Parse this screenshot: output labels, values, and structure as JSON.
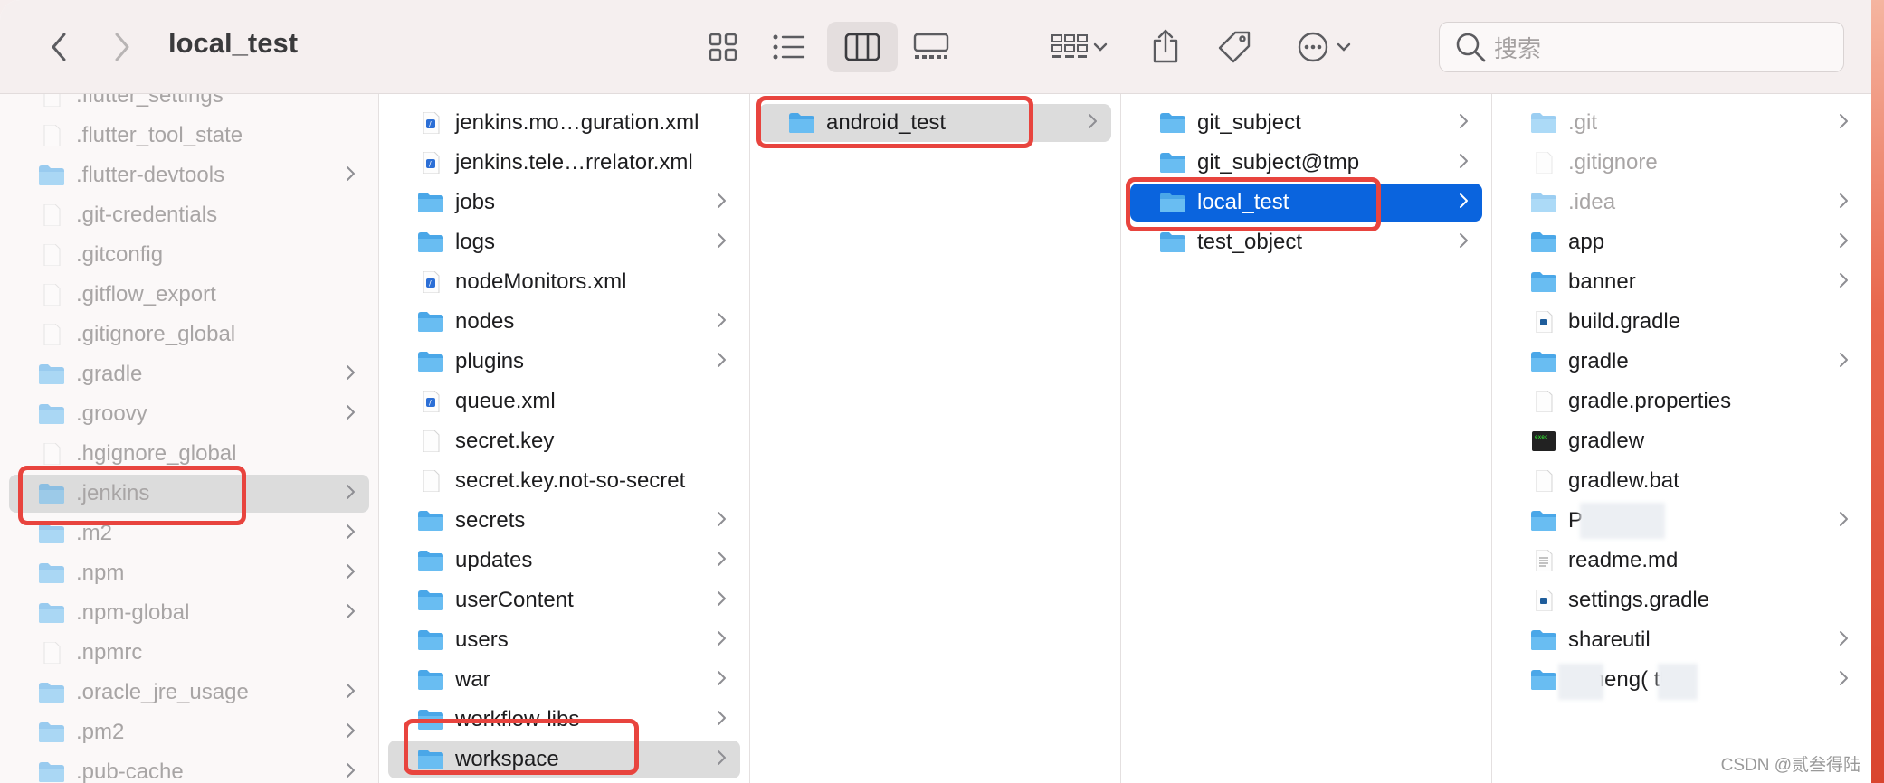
{
  "window": {
    "title": "local_test"
  },
  "toolbar": {
    "back": "chevron-left-icon",
    "forward": "chevron-right-icon",
    "search_placeholder": "搜索"
  },
  "columns": [
    {
      "items": [
        {
          "label": ".flutter_settings",
          "type": "file",
          "dim": true
        },
        {
          "label": ".flutter_tool_state",
          "type": "file",
          "dim": true
        },
        {
          "label": ".flutter-devtools",
          "type": "folder",
          "dim": true,
          "chevron": true
        },
        {
          "label": ".git-credentials",
          "type": "file",
          "dim": true
        },
        {
          "label": ".gitconfig",
          "type": "file",
          "dim": true
        },
        {
          "label": ".gitflow_export",
          "type": "file",
          "dim": true
        },
        {
          "label": ".gitignore_global",
          "type": "file",
          "dim": true
        },
        {
          "label": ".gradle",
          "type": "folder",
          "dim": true,
          "chevron": true
        },
        {
          "label": ".groovy",
          "type": "folder",
          "dim": true,
          "chevron": true
        },
        {
          "label": ".hgignore_global",
          "type": "file",
          "dim": true
        },
        {
          "label": ".jenkins",
          "type": "folder",
          "dim": true,
          "chevron": true,
          "selected": "gray"
        },
        {
          "label": ".m2",
          "type": "folder",
          "dim": true,
          "chevron": true
        },
        {
          "label": ".npm",
          "type": "folder",
          "dim": true,
          "chevron": true
        },
        {
          "label": ".npm-global",
          "type": "folder",
          "dim": true,
          "chevron": true
        },
        {
          "label": ".npmrc",
          "type": "file",
          "dim": true
        },
        {
          "label": ".oracle_jre_usage",
          "type": "folder",
          "dim": true,
          "chevron": true
        },
        {
          "label": ".pm2",
          "type": "folder",
          "dim": true,
          "chevron": true
        },
        {
          "label": ".pub-cache",
          "type": "folder",
          "dim": true,
          "chevron": true
        }
      ]
    },
    {
      "items": [
        {
          "label": "jenkins.mo…guration.xml",
          "type": "xml"
        },
        {
          "label": "jenkins.tele…rrelator.xml",
          "type": "xml"
        },
        {
          "label": "jobs",
          "type": "folder",
          "chevron": true
        },
        {
          "label": "logs",
          "type": "folder",
          "chevron": true
        },
        {
          "label": "nodeMonitors.xml",
          "type": "xml"
        },
        {
          "label": "nodes",
          "type": "folder",
          "chevron": true
        },
        {
          "label": "plugins",
          "type": "folder",
          "chevron": true
        },
        {
          "label": "queue.xml",
          "type": "xml"
        },
        {
          "label": "secret.key",
          "type": "file"
        },
        {
          "label": "secret.key.not-so-secret",
          "type": "file"
        },
        {
          "label": "secrets",
          "type": "folder",
          "chevron": true
        },
        {
          "label": "updates",
          "type": "folder",
          "chevron": true
        },
        {
          "label": "userContent",
          "type": "folder",
          "chevron": true
        },
        {
          "label": "users",
          "type": "folder",
          "chevron": true
        },
        {
          "label": "war",
          "type": "folder",
          "chevron": true
        },
        {
          "label": "workflow-libs",
          "type": "folder",
          "chevron": true
        },
        {
          "label": "workspace",
          "type": "folder",
          "chevron": true,
          "selected": "gray"
        }
      ]
    },
    {
      "items": [
        {
          "label": "android_test",
          "type": "folder",
          "chevron": true,
          "selected": "gray"
        }
      ]
    },
    {
      "items": [
        {
          "label": "git_subject",
          "type": "folder",
          "chevron": true
        },
        {
          "label": "git_subject@tmp",
          "type": "folder",
          "chevron": true
        },
        {
          "label": "local_test",
          "type": "folder",
          "chevron": true,
          "selected": "blue"
        },
        {
          "label": "test_object",
          "type": "folder",
          "chevron": true
        }
      ]
    },
    {
      "items": [
        {
          "label": ".git",
          "type": "folder",
          "dim": true,
          "chevron": true
        },
        {
          "label": ".gitignore",
          "type": "file",
          "dim": true
        },
        {
          "label": ".idea",
          "type": "folder",
          "dim": true,
          "chevron": true
        },
        {
          "label": "app",
          "type": "folder",
          "chevron": true
        },
        {
          "label": "banner",
          "type": "folder",
          "chevron": true
        },
        {
          "label": "build.gradle",
          "type": "gradle"
        },
        {
          "label": "gradle",
          "type": "folder",
          "chevron": true
        },
        {
          "label": "gradle.properties",
          "type": "file"
        },
        {
          "label": "gradlew",
          "type": "exec"
        },
        {
          "label": "gradlew.bat",
          "type": "file"
        },
        {
          "label": "Pu    Sl",
          "type": "folder",
          "chevron": true
        },
        {
          "label": "readme.md",
          "type": "doc"
        },
        {
          "label": "settings.gradle",
          "type": "gradle"
        },
        {
          "label": "shareutil",
          "type": "folder",
          "chevron": true
        },
        {
          "label": "       poneng(    tUI",
          "type": "folder",
          "chevron": true
        }
      ]
    }
  ],
  "watermark": "CSDN @贰叁得陆"
}
